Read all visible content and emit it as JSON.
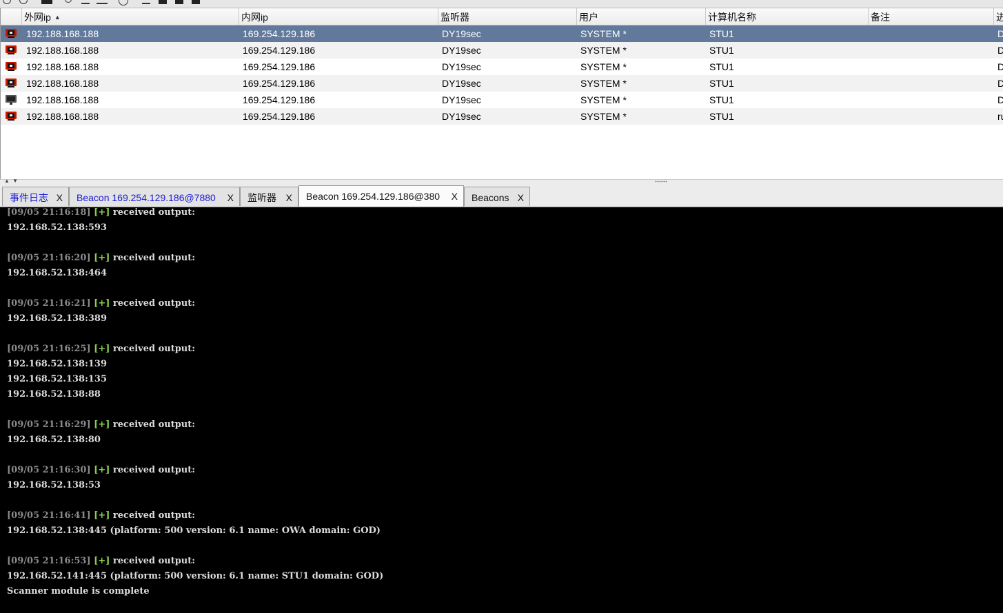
{
  "toolbar": {
    "icons": [
      "circle-icon",
      "circle-icon",
      "headphones-icon",
      "link-icon",
      "minus-icon",
      "monitor-icon",
      "globe-icon",
      "list-icon",
      "save-icon",
      "save-icon",
      "save-icon"
    ]
  },
  "table": {
    "columns": [
      {
        "label": "外网ip",
        "sorted": "ascending"
      },
      {
        "label": "内网ip"
      },
      {
        "label": "监听器"
      },
      {
        "label": "用户"
      },
      {
        "label": "计算机名称"
      },
      {
        "label": "备注"
      },
      {
        "label": "进"
      }
    ],
    "rows": [
      {
        "external_ip": "192.188.168.188",
        "internal_ip": "169.254.129.186",
        "listener": "DY19sec",
        "user": "SYSTEM *",
        "computer": "STU1",
        "note": "",
        "process": "D",
        "icon": "red-monitor-icon",
        "selected": true
      },
      {
        "external_ip": "192.188.168.188",
        "internal_ip": "169.254.129.186",
        "listener": "DY19sec",
        "user": "SYSTEM *",
        "computer": "STU1",
        "note": "",
        "process": "D",
        "icon": "red-monitor-icon"
      },
      {
        "external_ip": "192.188.168.188",
        "internal_ip": "169.254.129.186",
        "listener": "DY19sec",
        "user": "SYSTEM *",
        "computer": "STU1",
        "note": "",
        "process": "D",
        "icon": "red-monitor-icon"
      },
      {
        "external_ip": "192.188.168.188",
        "internal_ip": "169.254.129.186",
        "listener": "DY19sec",
        "user": "SYSTEM *",
        "computer": "STU1",
        "note": "",
        "process": "D",
        "icon": "red-monitor-icon"
      },
      {
        "external_ip": "192.188.168.188",
        "internal_ip": "169.254.129.186",
        "listener": "DY19sec",
        "user": "SYSTEM *",
        "computer": "STU1",
        "note": "",
        "process": "D",
        "icon": "gray-monitor-icon"
      },
      {
        "external_ip": "192.188.168.188",
        "internal_ip": "169.254.129.186",
        "listener": "DY19sec",
        "user": "SYSTEM *",
        "computer": "STU1",
        "note": "",
        "process": "ru",
        "icon": "red-monitor-icon"
      }
    ],
    "selected_color": "#62799c"
  },
  "tabs": [
    {
      "label": "事件日志",
      "close": "X",
      "style": "link"
    },
    {
      "label": "Beacon 169.254.129.186@7880",
      "close": "X",
      "style": "link"
    },
    {
      "label": "监听器",
      "close": "X",
      "style": "plain"
    },
    {
      "label": "Beacon 169.254.129.186@380",
      "close": "X",
      "style": "active"
    },
    {
      "label": "Beacons",
      "close": "X",
      "style": "plain"
    }
  ],
  "console": {
    "lines": [
      {
        "ts": "[09/05 21:16:18]",
        "tag": "[+]",
        "msg": "received output:"
      },
      {
        "out": "192.168.52.138:593"
      },
      {
        "blank": true
      },
      {
        "ts": "[09/05 21:16:20]",
        "tag": "[+]",
        "msg": "received output:"
      },
      {
        "out": "192.168.52.138:464"
      },
      {
        "blank": true
      },
      {
        "ts": "[09/05 21:16:21]",
        "tag": "[+]",
        "msg": "received output:"
      },
      {
        "out": "192.168.52.138:389"
      },
      {
        "blank": true
      },
      {
        "ts": "[09/05 21:16:25]",
        "tag": "[+]",
        "msg": "received output:"
      },
      {
        "out": "192.168.52.138:139"
      },
      {
        "out": "192.168.52.138:135"
      },
      {
        "out": "192.168.52.138:88"
      },
      {
        "blank": true
      },
      {
        "ts": "[09/05 21:16:29]",
        "tag": "[+]",
        "msg": "received output:"
      },
      {
        "out": "192.168.52.138:80"
      },
      {
        "blank": true
      },
      {
        "ts": "[09/05 21:16:30]",
        "tag": "[+]",
        "msg": "received output:"
      },
      {
        "out": "192.168.52.138:53"
      },
      {
        "blank": true
      },
      {
        "ts": "[09/05 21:16:41]",
        "tag": "[+]",
        "msg": "received output:"
      },
      {
        "out": "192.168.52.138:445 (platform: 500 version: 6.1 name: OWA domain: GOD)"
      },
      {
        "blank": true
      },
      {
        "ts": "[09/05 21:16:53]",
        "tag": "[+]",
        "msg": "received output:"
      },
      {
        "out": "192.168.52.141:445 (platform: 500 version: 6.1 name: STU1 domain: GOD)"
      },
      {
        "out": "Scanner module is complete"
      }
    ],
    "colors": {
      "background": "#000000",
      "timestamp": "#8a8a8a",
      "tag": "#8bd14f",
      "text": "#dcdcdc"
    }
  }
}
